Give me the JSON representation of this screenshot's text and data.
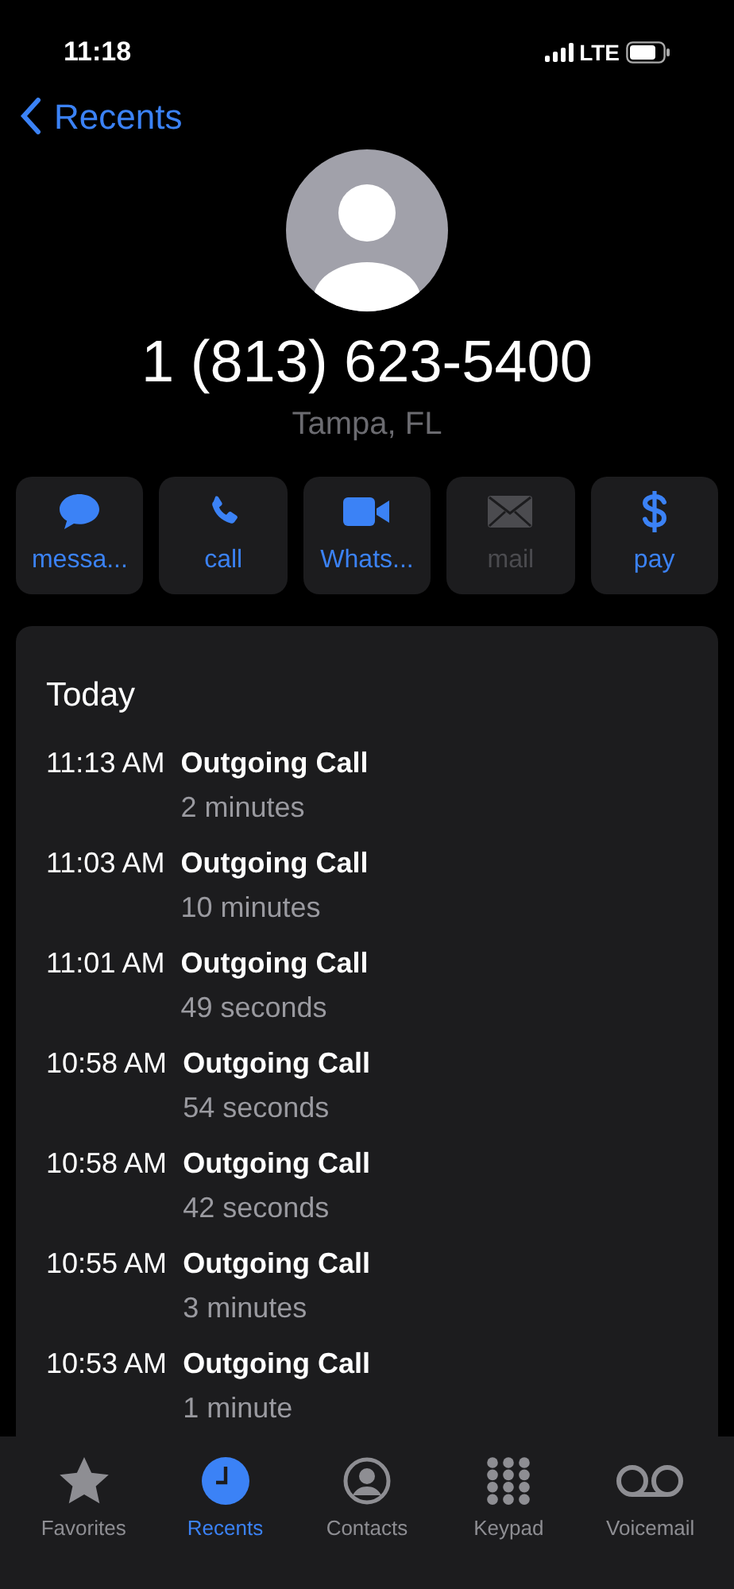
{
  "status_bar": {
    "time": "11:18",
    "network": "LTE"
  },
  "nav": {
    "back_label": "Recents"
  },
  "contact": {
    "number": "1 (813) 623-5400",
    "location": "Tampa, FL"
  },
  "actions": [
    {
      "kind": "message",
      "label": "messa...",
      "disabled": false
    },
    {
      "kind": "call",
      "label": "call",
      "disabled": false
    },
    {
      "kind": "video",
      "label": "Whats...",
      "disabled": false
    },
    {
      "kind": "mail",
      "label": "mail",
      "disabled": true
    },
    {
      "kind": "pay",
      "label": "pay",
      "disabled": false
    }
  ],
  "history": {
    "heading": "Today",
    "calls": [
      {
        "time": "11:13 AM",
        "type": "Outgoing Call",
        "duration": "2 minutes"
      },
      {
        "time": "11:03 AM",
        "type": "Outgoing Call",
        "duration": "10 minutes"
      },
      {
        "time": "11:01 AM",
        "type": "Outgoing Call",
        "duration": "49 seconds"
      },
      {
        "time": "10:58 AM",
        "type": "Outgoing Call",
        "duration": "54 seconds"
      },
      {
        "time": "10:58 AM",
        "type": "Outgoing Call",
        "duration": "42 seconds"
      },
      {
        "time": "10:55 AM",
        "type": "Outgoing Call",
        "duration": "3 minutes"
      },
      {
        "time": "10:53 AM",
        "type": "Outgoing Call",
        "duration": "1 minute"
      }
    ]
  },
  "tab_bar": [
    {
      "kind": "favorites",
      "label": "Favorites",
      "selected": false
    },
    {
      "kind": "recents",
      "label": "Recents",
      "selected": true
    },
    {
      "kind": "contacts",
      "label": "Contacts",
      "selected": false
    },
    {
      "kind": "keypad",
      "label": "Keypad",
      "selected": false
    },
    {
      "kind": "voicemail",
      "label": "Voicemail",
      "selected": false
    }
  ]
}
